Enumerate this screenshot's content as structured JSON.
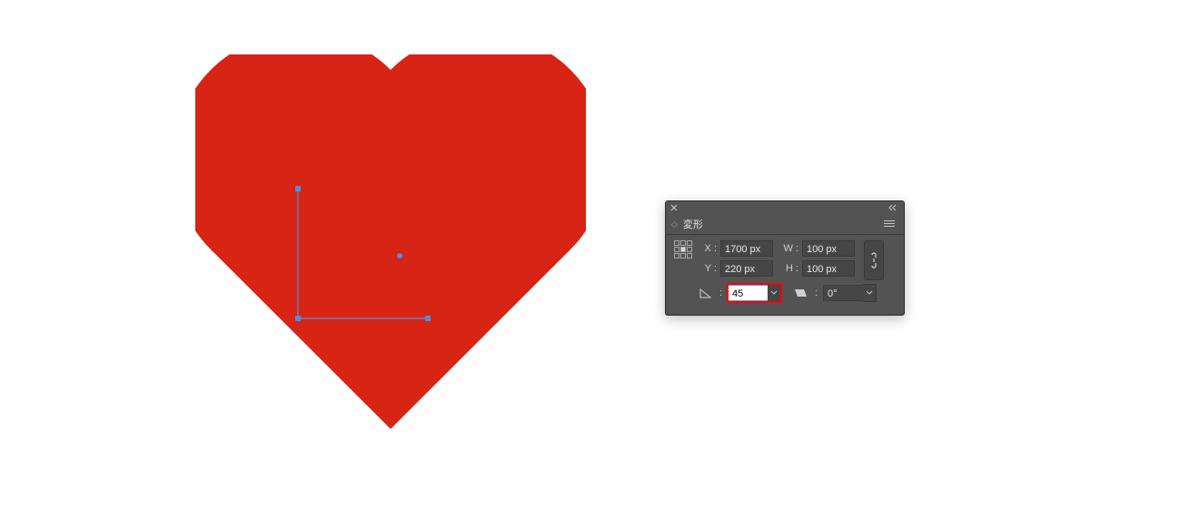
{
  "panel": {
    "title": "変形",
    "x_label": "X :",
    "y_label": "Y :",
    "w_label": "W :",
    "h_label": "H :",
    "x_value": "1700 px",
    "y_value": "220 px",
    "w_value": "100 px",
    "h_value": "100 px",
    "rotate_value": "45",
    "shear_value": "0°"
  },
  "colors": {
    "heart_fill": "#d72415",
    "selection_stroke": "#4f8fe2",
    "anchor_fill": "#4f8fe2"
  },
  "canvas": {
    "selected_shape": "path-L-shape",
    "anchor_center": true
  }
}
